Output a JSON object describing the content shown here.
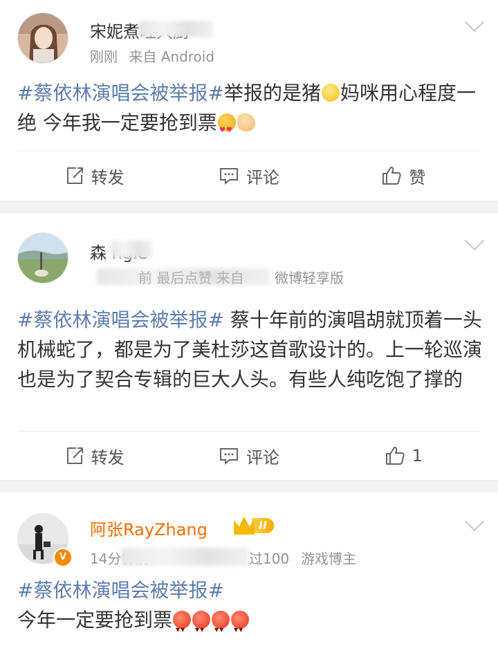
{
  "posts": [
    {
      "user_name": "宋妮煮旺大厨",
      "meta_time": "刚刚",
      "meta_source": "来自 Android",
      "hashtag": "#蔡依林演唱会被举报#",
      "text_before_emoji": "举报的是猪",
      "text_after_emoji": "妈咪用心程度一绝 今年我一定要抢到票",
      "actions": {
        "repost": "转发",
        "comment": "评论",
        "like": "赞"
      }
    },
    {
      "user_name": "森 ngle",
      "meta_prefix": "前 最后点赞 来自",
      "meta_source": "微博轻享版",
      "hashtag": "#蔡依林演唱会被举报#",
      "text": " 蔡十年前的演唱胡就顶着一头机械蛇了，都是为了美杜莎这首歌设计的。上一轮巡演也是为了契合专辑的巨大人头。有些人纯吃饱了撑的",
      "actions": {
        "repost": "转发",
        "comment": "评论",
        "like": "1"
      }
    },
    {
      "user_name": "阿张RayZhang",
      "level": "II",
      "verified_mark": "V",
      "meta_time": "14分钟前",
      "meta_mid": "过100",
      "meta_tag": "游戏博主",
      "hashtag": "#蔡依林演唱会被举报#",
      "text": "今年一定要抢到票"
    }
  ],
  "colors": {
    "hashtag": "#5d7cae",
    "vip_name": "#f86e00",
    "separator": "#f2f2f2"
  }
}
